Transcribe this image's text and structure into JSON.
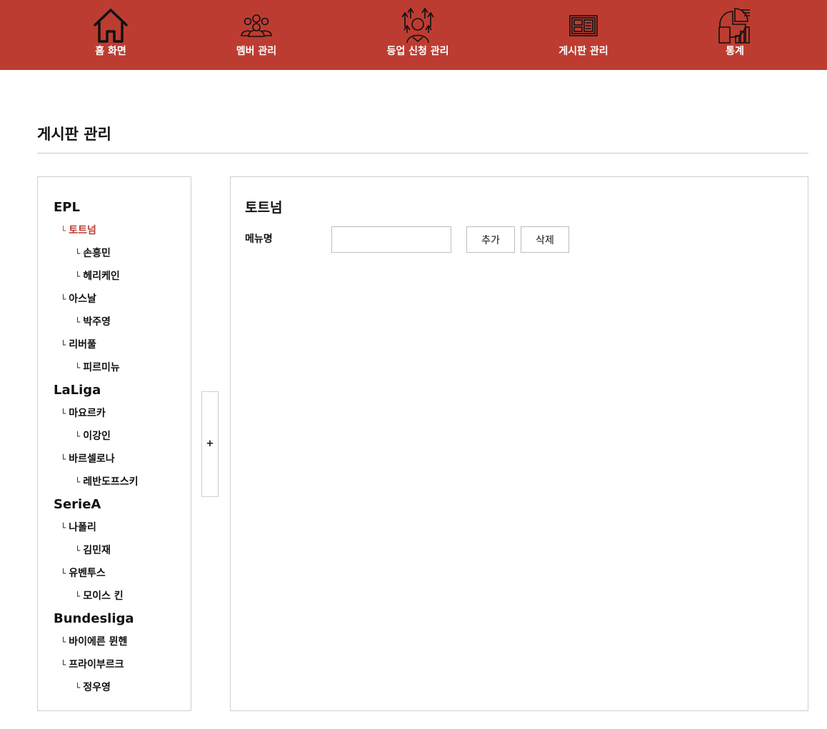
{
  "nav": {
    "items": [
      {
        "label": "홈 화면",
        "icon": "home-icon"
      },
      {
        "label": "멤버 관리",
        "icon": "members-icon"
      },
      {
        "label": "등업 신청 관리",
        "icon": "upgrade-request-icon"
      },
      {
        "label": "게시판 관리",
        "icon": "board-icon"
      },
      {
        "label": "통계",
        "icon": "statistics-icon"
      }
    ]
  },
  "colors": {
    "accent": "#bd3c31",
    "border": "#cfcfcf"
  },
  "page": {
    "title": "게시판 관리"
  },
  "tree": {
    "branch_glyph": "└",
    "selected": "토트넘",
    "leagues": [
      {
        "name": "EPL",
        "clubs": [
          {
            "name": "토트넘",
            "players": [
              "손흥민",
              "헤리케인"
            ]
          },
          {
            "name": "아스날",
            "players": [
              "박주영"
            ]
          },
          {
            "name": "리버풀",
            "players": [
              "피르미뉴"
            ]
          }
        ]
      },
      {
        "name": "LaLiga",
        "clubs": [
          {
            "name": "마요르카",
            "players": [
              "이강인"
            ]
          },
          {
            "name": "바르셀로나",
            "players": [
              "레반도프스키"
            ]
          }
        ]
      },
      {
        "name": "SerieA",
        "clubs": [
          {
            "name": "나폴리",
            "players": [
              "김민재"
            ]
          },
          {
            "name": "유벤투스",
            "players": [
              "모이스 킨"
            ]
          }
        ]
      },
      {
        "name": "Bundesliga",
        "clubs": [
          {
            "name": "바이에른 뮌헨",
            "players": []
          },
          {
            "name": "프라이부르크",
            "players": [
              "정우영"
            ]
          }
        ]
      }
    ]
  },
  "plus_button": {
    "label": "+"
  },
  "detail": {
    "title": "토트넘",
    "field_label": "메뉴명",
    "input_value": "",
    "input_placeholder": "",
    "add_label": "추가",
    "delete_label": "삭제"
  }
}
